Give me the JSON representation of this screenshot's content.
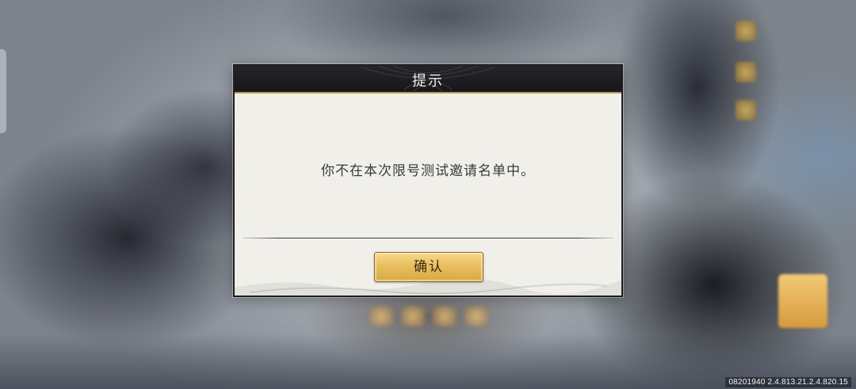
{
  "dialog": {
    "title": "提示",
    "message": "你不在本次限号测试邀请名单中。",
    "confirm_label": "确认"
  },
  "footer": {
    "version": "08201940 2.4.813.21.2.4.820.15"
  },
  "colors": {
    "header_bg": "#1b1b1f",
    "dialog_bg": "#f0efea",
    "button_gold": "#e9bf5e",
    "header_trim": "#b8964e"
  }
}
